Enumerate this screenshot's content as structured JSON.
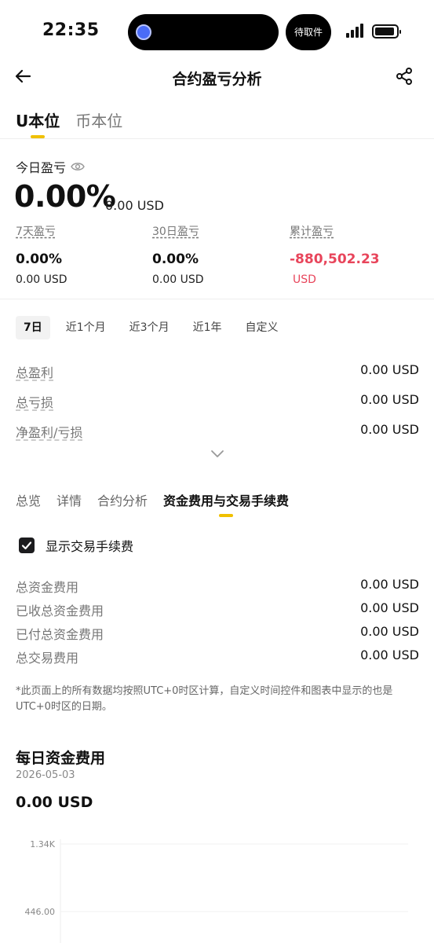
{
  "status_bar": {
    "time": "22:35",
    "pill_text": "待取件"
  },
  "header": {
    "title": "合约盈亏分析"
  },
  "unit_tabs": [
    {
      "label": "U本位",
      "active": true
    },
    {
      "label": "币本位",
      "active": false
    }
  ],
  "today": {
    "label": "今日盈亏",
    "pct": "0.00%",
    "usd": "0.00 USD"
  },
  "stats": [
    {
      "label": "7天盈亏",
      "pct": "0.00%",
      "usd": "0.00 USD"
    },
    {
      "label": "30日盈亏",
      "pct": "0.00%",
      "usd": "0.00 USD"
    },
    {
      "label": "累计盈亏",
      "pct": "-880,502.23",
      "usd": "USD"
    }
  ],
  "periods": [
    {
      "label": "7日",
      "active": true
    },
    {
      "label": "近1个月",
      "active": false
    },
    {
      "label": "近3个月",
      "active": false
    },
    {
      "label": "近1年",
      "active": false
    },
    {
      "label": "自定义",
      "active": false
    }
  ],
  "summary": [
    {
      "label": "总盈利",
      "value": "0.00 USD"
    },
    {
      "label": "总亏损",
      "value": "0.00 USD"
    },
    {
      "label": "净盈利/亏损",
      "value": "0.00 USD"
    }
  ],
  "section_tabs": [
    {
      "label": "总览",
      "active": false
    },
    {
      "label": "详情",
      "active": false
    },
    {
      "label": "合约分析",
      "active": false
    },
    {
      "label": "资金费用与交易手续费",
      "active": true
    }
  ],
  "fees_checkbox": {
    "label": "显示交易手续费",
    "checked": true
  },
  "fees": [
    {
      "label": "总资金费用",
      "value": "0.00 USD"
    },
    {
      "label": "已收总资金费用",
      "value": "0.00 USD"
    },
    {
      "label": "已付总资金费用",
      "value": "0.00 USD"
    },
    {
      "label": "总交易费用",
      "value": "0.00 USD"
    }
  ],
  "note": "*此页面上的所有数据均按照UTC+0时区计算，自定义时间控件和图表中显示的也是UTC+0时区的日期。",
  "daily": {
    "title": "每日资金费用",
    "date": "2026-05-03",
    "value": "0.00 USD"
  },
  "chart_data": {
    "type": "bar",
    "y_ticks": [
      "1.34K",
      "446.00"
    ],
    "ylim_top": 1340
  },
  "colors": {
    "accent": "#f0c000",
    "negative": "#e8455b"
  }
}
